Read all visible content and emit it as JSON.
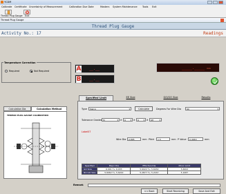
{
  "window": {
    "title": "YCDM"
  },
  "menu": [
    "Calibrate",
    "Certificate",
    "Uncertainty of Measurement",
    "Calibration Due Date",
    "Masters",
    "System Maintenance",
    "Tools",
    "Exit"
  ],
  "toolbar": {
    "btn1_label": "Thread Plug Gauge",
    "btn2_label": "Exit"
  },
  "child": {
    "title": "Thread Plug Gauge"
  },
  "heading": "Thread Plug Gauge",
  "activity": {
    "label": "Activity No.: 17",
    "readings": "Readings"
  },
  "temperature": {
    "legend": "Temperature Correction",
    "required": "Required",
    "not_required": "Not Required"
  },
  "displays": {
    "a_label": "A",
    "a_value": "__.__",
    "b_label": "B",
    "b_value": "__.__",
    "readout_value": "_____._____",
    "readout_unit": "mm"
  },
  "left_tabs": [
    "Calculation Dia",
    "Calculation Method"
  ],
  "drawing_caption": "THREAD PLUG GAUGE CALIBRATION",
  "right_tabs": [
    "Specified Limit",
    "EE Size",
    "GO/GO Size",
    "Results"
  ],
  "form": {
    "type_label": "Type",
    "type_value": "Metric",
    "calculate": "Calculate",
    "degrees_label": "Degrees For Wire Dia",
    "degrees_value": "60",
    "tol_label": "Tolerance Grades",
    "tol1": "M",
    "tol2": "6",
    "tol3": "6",
    "tol4": "6H",
    "tol_x": "X",
    "label07": "Label07",
    "wire_label": "Wire Dia",
    "wire_value": "0.895",
    "mm1": "mm",
    "pitch_label": "Pitch",
    "pitch_value": "1.5",
    "mm2": "mm",
    "pval_label": "P Value",
    "pval_value": "0.4940",
    "mm3": "mm"
  },
  "table": {
    "headers": [
      "Specified",
      "Major Dia",
      "Effective Dia",
      "Minor Limit"
    ],
    "rows": [
      [
        "GO Size",
        "6.991 T+ 6.933",
        "5.6022 T+ 5.6432",
        "5.6002"
      ],
      [
        "NO GO Size",
        "5.6062 T+ 5.6222",
        "5.2877 T+ 5.2167",
        "5.1087"
      ]
    ]
  },
  "remark_label": "Remark",
  "buttons": {
    "back": "<< Back",
    "start": "Start Receiving",
    "save": "Save And Exit"
  },
  "colors": {
    "heading_text": "#2b4f78",
    "readings_text": "#c13c12",
    "display_bg": "#1a1a1a"
  }
}
